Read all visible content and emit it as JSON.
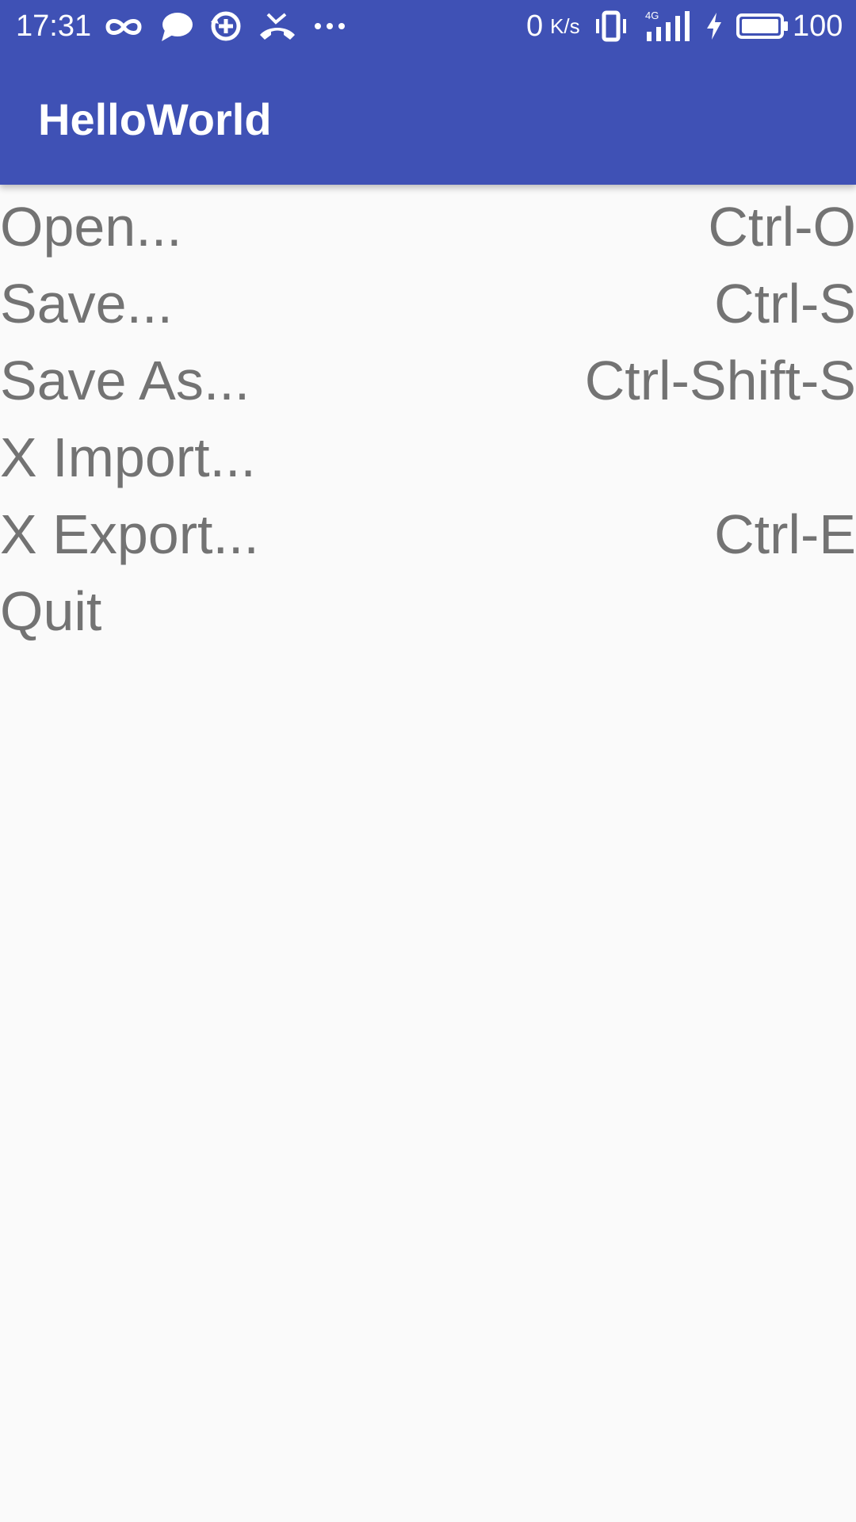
{
  "status_bar": {
    "time": "17:31",
    "net_speed": "0",
    "net_unit": "K/s",
    "battery": "100",
    "icons": [
      "infinity-icon",
      "chat-bubble-icon",
      "sync-icon",
      "missed-call-icon",
      "more-dots-icon",
      "vibrate-icon",
      "signal-4g-icon",
      "charging-icon",
      "battery-icon"
    ]
  },
  "app_bar": {
    "title": "HelloWorld",
    "color": "#3f51b5"
  },
  "menu": {
    "items": [
      {
        "label": "Open...",
        "shortcut": "Ctrl-O"
      },
      {
        "label": "Save...",
        "shortcut": "Ctrl-S"
      },
      {
        "label": "Save As...",
        "shortcut": "Ctrl-Shift-S"
      },
      {
        "label": "X Import...",
        "shortcut": ""
      },
      {
        "label": "X Export...",
        "shortcut": "Ctrl-E"
      },
      {
        "label": "Quit",
        "shortcut": ""
      }
    ]
  }
}
